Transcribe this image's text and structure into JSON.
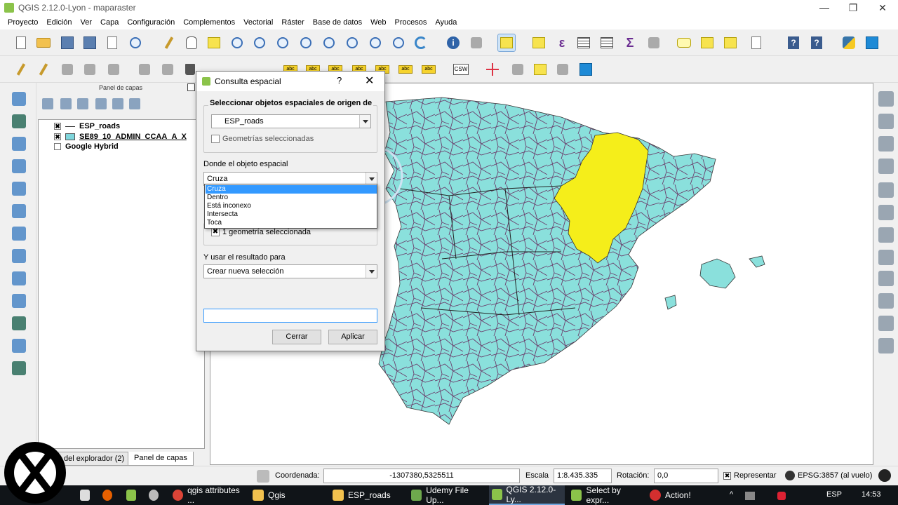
{
  "window": {
    "title": "QGIS 2.12.0-Lyon - maparaster",
    "controls": [
      "—",
      "❐",
      "✕"
    ]
  },
  "menubar": [
    "Proyecto",
    "Edición",
    "Ver",
    "Capa",
    "Configuración",
    "Complementos",
    "Vectorial",
    "Ráster",
    "Base de datos",
    "Web",
    "Procesos",
    "Ayuda"
  ],
  "toolbar2": {
    "csw": "CSW",
    "label_tag": "abc"
  },
  "layers_panel": {
    "title": "Panel de capas",
    "layers": [
      {
        "name": "ESP_roads",
        "checked": "✖",
        "symbol": "line"
      },
      {
        "name": "SE89_10_ADMIN_CCAA_A_X",
        "checked": "✖",
        "symbol": "polygon"
      },
      {
        "name": "Google Hybrid",
        "checked": "",
        "symbol": "none"
      }
    ],
    "tabs": [
      "del explorador (2)",
      "Panel de capas"
    ]
  },
  "dialog": {
    "title": "Consulta espacial",
    "help": "?",
    "close": "✕",
    "source_group_label": "Seleccionar objetos espaciales de origen de",
    "source_layer": "ESP_roads",
    "selected_geom_label": "Geometrías seleccionadas",
    "where_label": "Donde el objeto espacial",
    "where_value": "Cruza",
    "where_options": [
      "Cruza",
      "Dentro",
      "Está inconexo",
      "Intersecta",
      "Toca"
    ],
    "target_selected_label": "1 geometría seleccionada",
    "target_selected_check": "✖",
    "use_result_label": "Y usar el resultado para",
    "use_result_value": "Crear nueva selección",
    "result_field_value": "",
    "close_button": "Cerrar",
    "apply_button": "Aplicar"
  },
  "statusbar": {
    "coord_label": "Coordenada:",
    "coord_value": "-1307380,5325511",
    "scale_label": "Escala",
    "scale_value": "1:8.435.335",
    "rotation_label": "Rotación:",
    "rotation_value": "0,0",
    "render_check": "✖",
    "render_label": "Representar",
    "crs_label": "EPSG:3857 (al vuelo)"
  },
  "taskbar": {
    "items": [
      "qgis attributes ...",
      "Qgis",
      "ESP_roads",
      "Udemy File Up...",
      "QGIS 2.12.0-Ly...",
      "Select by expr...",
      "Action!"
    ],
    "lang": "ESP",
    "time": "14:53"
  },
  "logo": {
    "text": "X"
  },
  "colors": {
    "provinces": "#8ae0dc",
    "selected_region": "#f5ee1a",
    "roads": "#6b3d6b",
    "accent": "#3399ff"
  }
}
